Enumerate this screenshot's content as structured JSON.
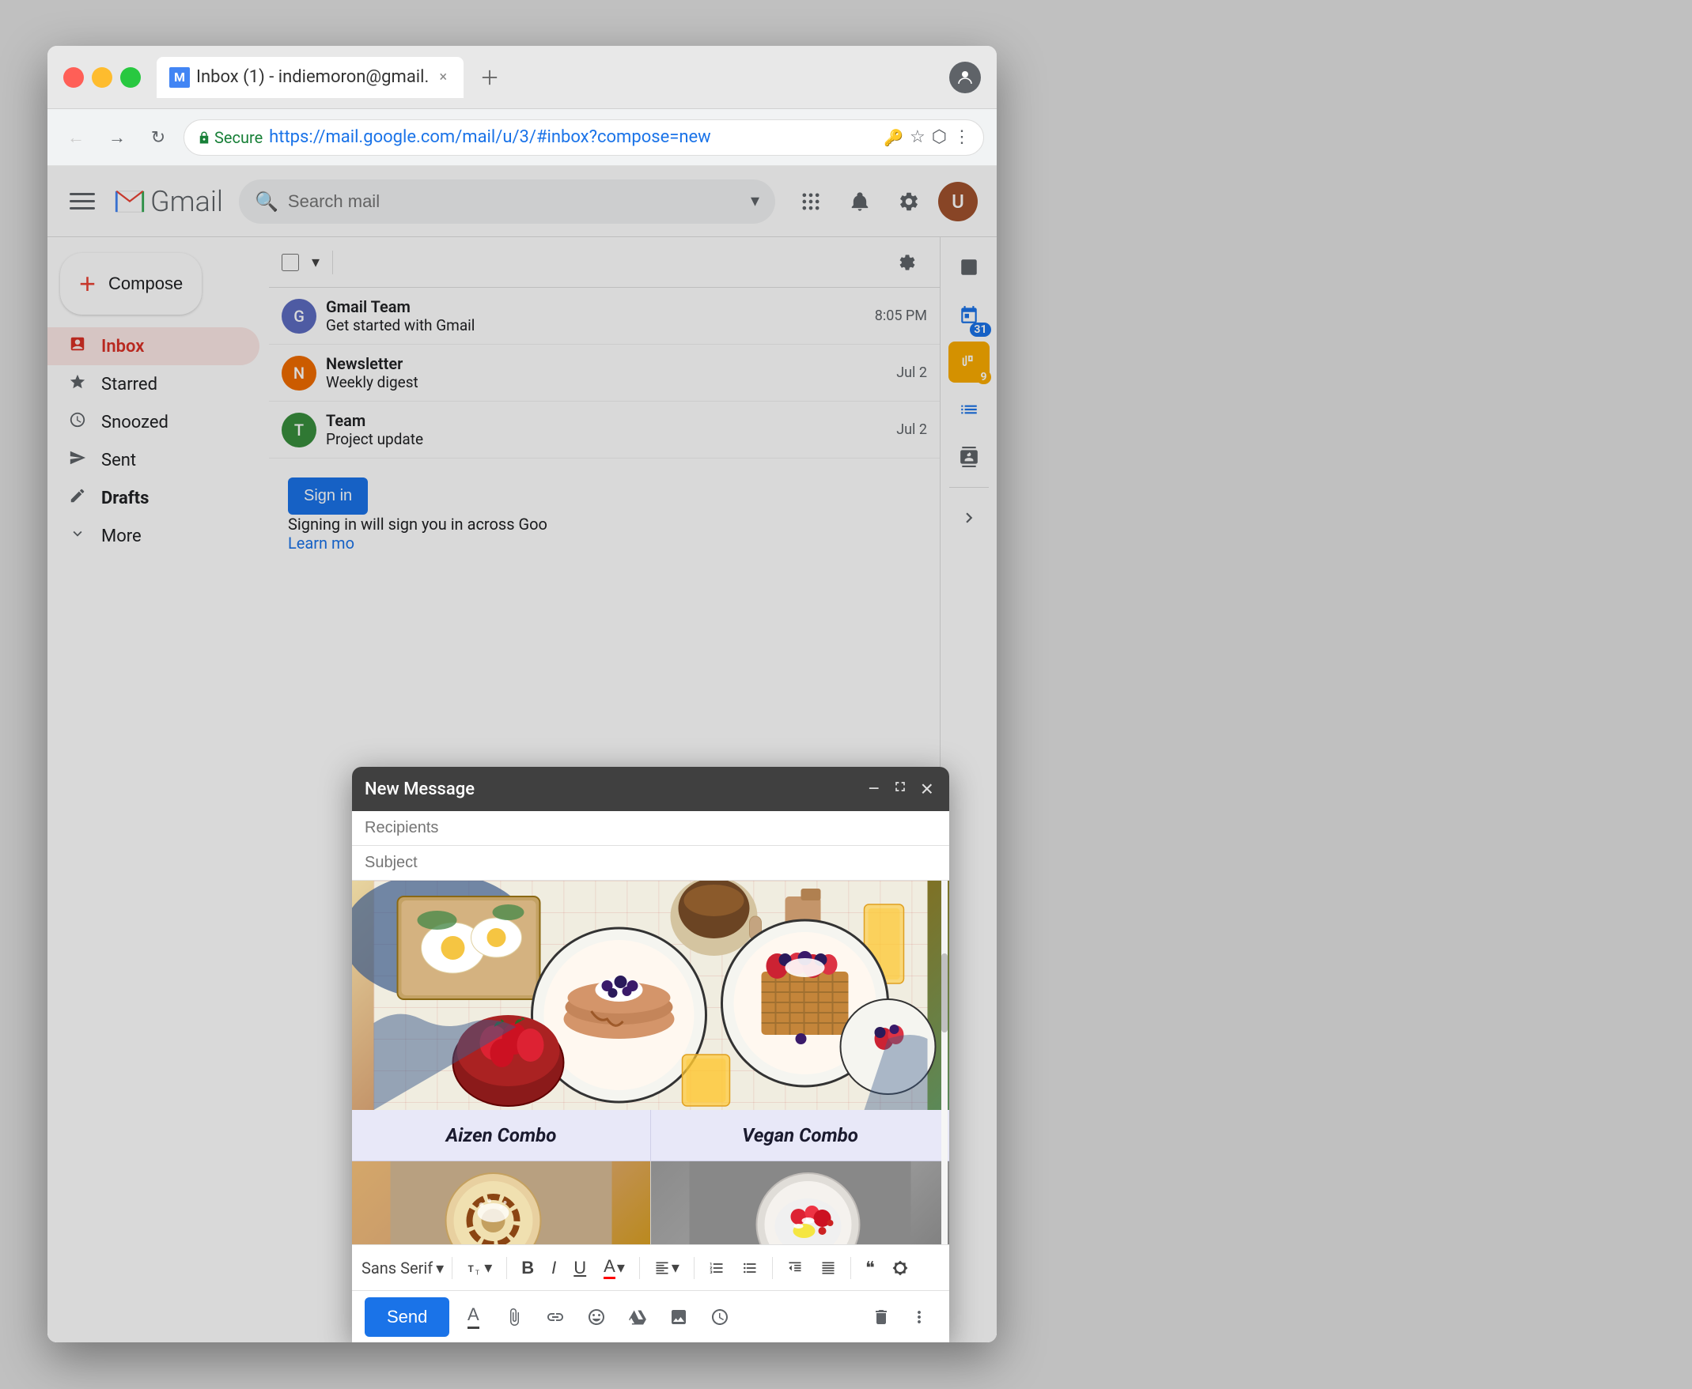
{
  "window": {
    "title": "Inbox (1) - indiemoron@gmail.",
    "url_display": "Secure",
    "url_full": "https://mail.google.com/mail/u/3/#inbox?compose=new",
    "tab_label": "Inbox (1) - indiemoron@gmail."
  },
  "gmail": {
    "logo_letter": "M",
    "logo_text": "Gmail",
    "search_placeholder": "Search mail",
    "compose_label": "Compose",
    "sidebar": {
      "items": [
        {
          "id": "inbox",
          "label": "Inbox",
          "icon": "📥",
          "active": true,
          "count": ""
        },
        {
          "id": "starred",
          "label": "Starred",
          "icon": "☆",
          "active": false,
          "count": ""
        },
        {
          "id": "snoozed",
          "label": "Snoozed",
          "icon": "🕐",
          "active": false,
          "count": ""
        },
        {
          "id": "sent",
          "label": "Sent",
          "icon": "▷",
          "active": false,
          "count": ""
        },
        {
          "id": "drafts",
          "label": "Drafts",
          "icon": "📄",
          "active": false,
          "count": ""
        },
        {
          "id": "more",
          "label": "More",
          "icon": "∨",
          "active": false,
          "count": ""
        }
      ]
    },
    "sign_in": {
      "button_label": "Sign in",
      "text": "Signing in will sign you in across Goo",
      "link_text": "Learn mo"
    }
  },
  "compose": {
    "title": "New Message",
    "recipients_placeholder": "Recipients",
    "subject_placeholder": "Subject",
    "send_button": "Send",
    "minimize_icon": "−",
    "expand_icon": "⤢",
    "close_icon": "×",
    "food_combo_left": "Aizen Combo",
    "food_combo_right": "Vegan Combo",
    "format_toolbar": {
      "font_family": "Sans Serif",
      "font_size": "▾",
      "bold": "B",
      "italic": "I",
      "underline": "U",
      "text_color": "A",
      "align": "≡",
      "numbered_list": "≡",
      "bullet_list": "≡",
      "indent": "⇥",
      "outdent": "⇤",
      "quote": "❝",
      "remove_format": "✕"
    },
    "bottom_toolbar_icons": [
      "A",
      "📎",
      "🔗",
      "😊",
      "△",
      "🖼",
      "⏰"
    ]
  },
  "email_list": {
    "times": [
      "8:05 PM",
      "Jul 2",
      "Jul 2"
    ],
    "email1_time": "8:05 PM",
    "email2_time": "Jul 2",
    "email3_time": "Jul 2",
    "more_icon": "+"
  },
  "right_panel": {
    "calendar_badge": "31",
    "keep_badge": "9"
  },
  "colors": {
    "gmail_red": "#ea4335",
    "gmail_blue": "#1a73e8",
    "gmail_yellow": "#f9ab00",
    "gmail_green": "#34a853",
    "compose_header": "#404040",
    "inbox_active": "#fce8e6",
    "inbox_active_text": "#d93025"
  }
}
